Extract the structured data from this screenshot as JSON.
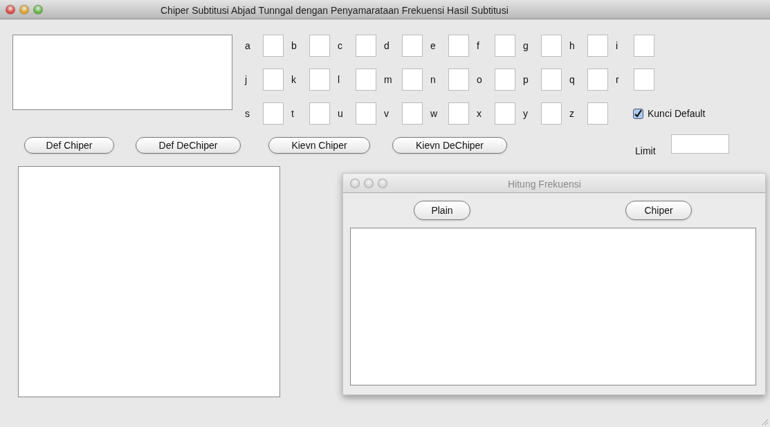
{
  "window": {
    "title": "Chiper Subtitusi Abjad Tunngal dengan Penyamarataan Frekuensi Hasil Subtitusi"
  },
  "letters": [
    {
      "label": "a"
    },
    {
      "label": "b"
    },
    {
      "label": "c"
    },
    {
      "label": "d"
    },
    {
      "label": "e"
    },
    {
      "label": "f"
    },
    {
      "label": "g"
    },
    {
      "label": "h"
    },
    {
      "label": "i"
    },
    {
      "label": "j"
    },
    {
      "label": "k"
    },
    {
      "label": "l"
    },
    {
      "label": "m"
    },
    {
      "label": "n"
    },
    {
      "label": "o"
    },
    {
      "label": "p"
    },
    {
      "label": "q"
    },
    {
      "label": "r"
    },
    {
      "label": "s"
    },
    {
      "label": "t"
    },
    {
      "label": "u"
    },
    {
      "label": "v"
    },
    {
      "label": "w"
    },
    {
      "label": "x"
    },
    {
      "label": "y"
    },
    {
      "label": "z"
    }
  ],
  "kunci_default": {
    "label": "Kunci Default",
    "checked": true
  },
  "buttons": [
    "Def Chiper",
    "Def DeChiper",
    "Kievn Chiper",
    "Kievn DeChiper"
  ],
  "limit": {
    "label": "Limit"
  },
  "dialog": {
    "title": "Hitung Frekuensi",
    "buttons": [
      "Plain",
      "Chiper"
    ]
  }
}
